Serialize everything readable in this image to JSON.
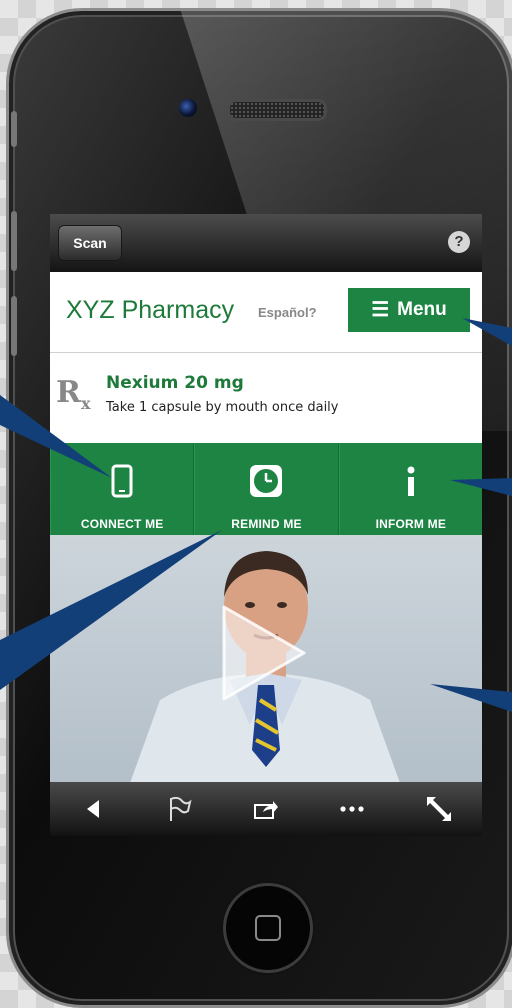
{
  "app": {
    "back_label": "Scan",
    "help_glyph": "?"
  },
  "header": {
    "pharmacy_name": "XYZ Pharmacy",
    "language_link": "Español?",
    "menu_label": "Menu",
    "menu_icon": "list-icon"
  },
  "prescription": {
    "rx_icon": "rx-symbol",
    "drug": "Nexium 20 mg",
    "instructions": "Take 1 capsule by mouth once daily"
  },
  "actions": [
    {
      "label": "CONNECT ME",
      "icon": "phone-icon"
    },
    {
      "label": "REMIND ME",
      "icon": "clock-icon"
    },
    {
      "label": "INFORM ME",
      "icon": "info-icon"
    }
  ],
  "video": {
    "play_icon": "play-icon"
  },
  "toolbar": {
    "icons": [
      "back-arrow-icon",
      "flag-icon",
      "share-icon",
      "more-icon",
      "fullscreen-icon"
    ]
  },
  "colors": {
    "brand_green": "#1d8444",
    "text_green": "#1e7a3a",
    "callout_blue": "#123f78"
  }
}
